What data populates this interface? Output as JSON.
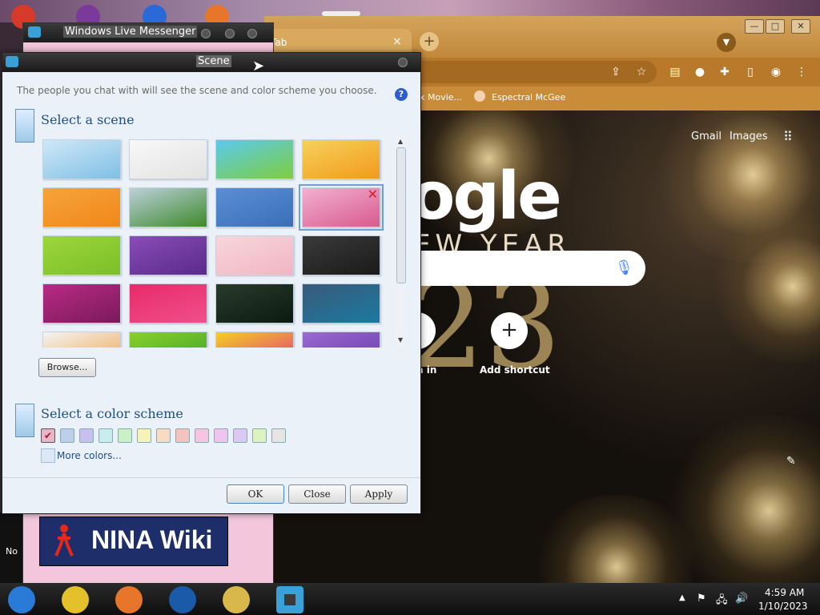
{
  "messenger_window": {
    "title": "Windows Live Messenger",
    "ad_text": "NINA Wiki"
  },
  "left_edge_text": "No",
  "chrome": {
    "tab_title": "Tab",
    "tab_close": "×",
    "new_tab": "+",
    "bookmarks": [
      "x Movie...",
      "Espectral McGee"
    ],
    "links": {
      "gmail": "Gmail",
      "images": "Images"
    },
    "logo_text": "ogle",
    "logo_sub": "EW YEAR",
    "logo_number": "23",
    "shortcuts": [
      {
        "label": "n in"
      },
      {
        "label": "Add shortcut",
        "symbol": "+"
      }
    ],
    "colors": {
      "frame": "#c98d3a",
      "page_bg": "#0c0a08"
    }
  },
  "scene_dialog": {
    "title": "Scene",
    "description": "The people you chat with will see the scene and color scheme you choose.",
    "help": "?",
    "select_scene": "Select a scene",
    "browse": "Browse...",
    "select_color_scheme": "Select a color scheme",
    "more_colors": "More colors...",
    "buttons": {
      "ok": "OK",
      "close": "Close",
      "apply": "Apply"
    },
    "selected_scene_index": 7,
    "selected_color_index": 0,
    "scene_thumbnails": [
      {
        "name": "sky-blue",
        "colors": [
          "#cfe8f6",
          "#7fbfe6"
        ]
      },
      {
        "name": "white-clouds",
        "colors": [
          "#f8f8f8",
          "#e2e2e2"
        ]
      },
      {
        "name": "green-hill",
        "colors": [
          "#5cc8f0",
          "#7dcf3c"
        ]
      },
      {
        "name": "autumn-tree",
        "colors": [
          "#f7d15a",
          "#f29a1c"
        ]
      },
      {
        "name": "orange-grass",
        "colors": [
          "#f7a43a",
          "#f0871a"
        ]
      },
      {
        "name": "green-field",
        "colors": [
          "#bcd0dc",
          "#3e8a2a"
        ]
      },
      {
        "name": "blue-mountains",
        "colors": [
          "#5b8fd4",
          "#3a6fb8"
        ]
      },
      {
        "name": "pink-collage",
        "colors": [
          "#f3b0d0",
          "#d85a90"
        ]
      },
      {
        "name": "lime-green",
        "colors": [
          "#9cd63c",
          "#7bbf28"
        ]
      },
      {
        "name": "purple-swirl",
        "colors": [
          "#8a4cb8",
          "#5a2a8a"
        ]
      },
      {
        "name": "pink-blossom",
        "colors": [
          "#f8d6dc",
          "#f0b6c2"
        ]
      },
      {
        "name": "dark-pattern",
        "colors": [
          "#3a3a3a",
          "#1a1a1a"
        ]
      },
      {
        "name": "magenta-heart",
        "colors": [
          "#b82a86",
          "#7a1a5a"
        ]
      },
      {
        "name": "red-burst",
        "colors": [
          "#e82a6a",
          "#f0508a"
        ]
      },
      {
        "name": "dark-green-streak",
        "colors": [
          "#2a3a2a",
          "#0a1a10"
        ]
      },
      {
        "name": "ocean-scene",
        "colors": [
          "#3a5a7a",
          "#1a7aa0"
        ]
      },
      {
        "name": "white-orange",
        "colors": [
          "#f4f4f4",
          "#f0a24a"
        ]
      },
      {
        "name": "green-bamboo",
        "colors": [
          "#8ad02a",
          "#3aa02a"
        ]
      },
      {
        "name": "colorful-blobs",
        "colors": [
          "#f5d020",
          "#e0308a"
        ]
      },
      {
        "name": "purple-cartoon",
        "colors": [
          "#9a6ad0",
          "#6a3aa8"
        ]
      }
    ],
    "color_swatches": [
      "#e7b7c7",
      "#bcd0ec",
      "#c6c1ef",
      "#c7edf0",
      "#c9f0c8",
      "#f5f3b9",
      "#f7dcc5",
      "#f5c2c2",
      "#f5c5e2",
      "#f0c4ef",
      "#dbc9f3",
      "#dcf2c2",
      "#e5e5e5"
    ]
  },
  "taskbar": {
    "time": "4:59 AM",
    "date": "1/10/2023",
    "apps": [
      "chrome-canary-icon",
      "chrome-icon",
      "firefox-icon",
      "obama-logo-icon",
      "file-explorer-icon",
      "messenger-icon"
    ]
  }
}
